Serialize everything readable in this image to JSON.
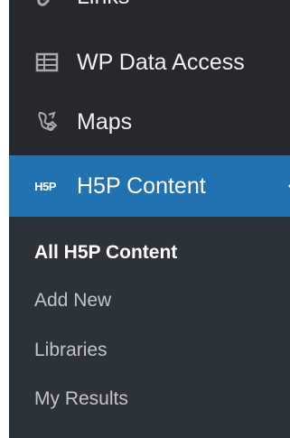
{
  "menu": {
    "items": [
      {
        "label": "Links",
        "icon": "link-icon"
      },
      {
        "label": "WP Data Access",
        "icon": "table-icon"
      },
      {
        "label": "Maps",
        "icon": "map-marker-icon"
      },
      {
        "label": "H5P Content",
        "icon": "h5p-icon",
        "active": true
      }
    ],
    "h5p_icon_text": "H5P"
  },
  "submenu": {
    "items": [
      {
        "label": "All H5P Content",
        "current": true
      },
      {
        "label": "Add New"
      },
      {
        "label": "Libraries"
      },
      {
        "label": "My Results"
      }
    ]
  },
  "colors": {
    "sidebar_bg": "#24292e",
    "submenu_bg": "#2c3338",
    "active_bg": "#2271b1",
    "text": "#f0f0f1",
    "icon": "#a7aaad",
    "submenu_text": "#c3c4c7"
  }
}
